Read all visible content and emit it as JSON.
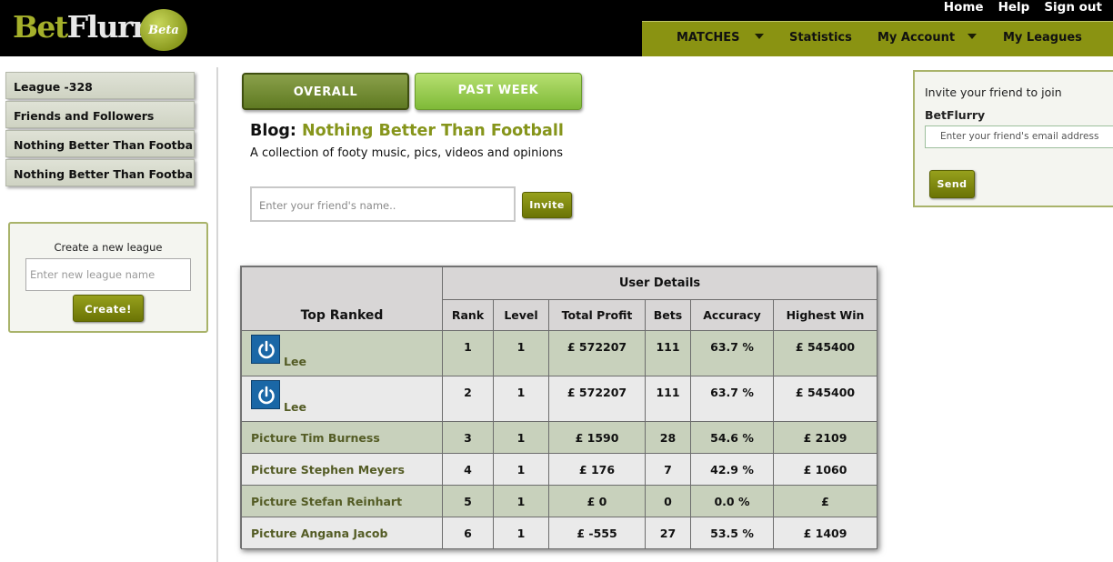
{
  "header": {
    "logo_main_1": "Bet",
    "logo_main_2": "Flurry",
    "logo_badge": "Beta",
    "top_links": [
      "Home",
      "Help",
      "Sign out"
    ],
    "menu": [
      {
        "label": "MATCHES",
        "dropdown": true
      },
      {
        "label": "Statistics",
        "dropdown": false
      },
      {
        "label": "My Account",
        "dropdown": true
      },
      {
        "label": "My Leagues",
        "dropdown": false
      }
    ]
  },
  "sidebar": {
    "leagues": [
      "League -328",
      "Friends and Followers",
      "Nothing Better Than Football",
      "Nothing Better Than Football"
    ],
    "create": {
      "title": "Create a new league",
      "placeholder": "Enter new league name",
      "button": "Create!"
    }
  },
  "main": {
    "tabs": [
      "OVERALL",
      "PAST WEEK"
    ],
    "blog_prefix": "Blog:",
    "blog_name": "Nothing Better Than Football",
    "blog_desc": "A collection of footy music, pics, videos and opinions",
    "friend_placeholder": "Enter your friend's name..",
    "invite_button": "Invite"
  },
  "invite_box": {
    "line1": "Invite your friend to join",
    "line2": "BetFlurry",
    "email_placeholder": "Enter your friend's email address",
    "send_button": "Send"
  },
  "table": {
    "group_header": "User Details",
    "first_header": "Top Ranked",
    "columns": [
      "Rank",
      "Level",
      "Total Profit",
      "Bets",
      "Accuracy",
      "Highest Win"
    ],
    "rows": [
      {
        "name": "Lee",
        "avatar": true,
        "rank": "1",
        "level": "1",
        "profit": "£ 572207",
        "bets": "111",
        "accuracy": "63.7 %",
        "highest": "£ 545400"
      },
      {
        "name": "Lee",
        "avatar": true,
        "rank": "2",
        "level": "1",
        "profit": "£ 572207",
        "bets": "111",
        "accuracy": "63.7 %",
        "highest": "£ 545400"
      },
      {
        "name": "Picture Tim Burness",
        "avatar": false,
        "rank": "3",
        "level": "1",
        "profit": "£ 1590",
        "bets": "28",
        "accuracy": "54.6 %",
        "highest": "£ 2109"
      },
      {
        "name": "Picture Stephen Meyers",
        "avatar": false,
        "rank": "4",
        "level": "1",
        "profit": "£ 176",
        "bets": "7",
        "accuracy": "42.9 %",
        "highest": "£ 1060"
      },
      {
        "name": "Picture Stefan Reinhart",
        "avatar": false,
        "rank": "5",
        "level": "1",
        "profit": "£ 0",
        "bets": "0",
        "accuracy": "0.0 %",
        "highest": "£"
      },
      {
        "name": "Picture Angana Jacob",
        "avatar": false,
        "rank": "6",
        "level": "1",
        "profit": "£ -555",
        "bets": "27",
        "accuracy": "53.5 %",
        "highest": "£ 1409"
      }
    ]
  },
  "colors": {
    "header_bg": "#000000",
    "menu_bg": "#8a9312",
    "accent_green": "#86951b",
    "row_green": "#c8d1bc",
    "row_grey": "#eaeaea"
  }
}
